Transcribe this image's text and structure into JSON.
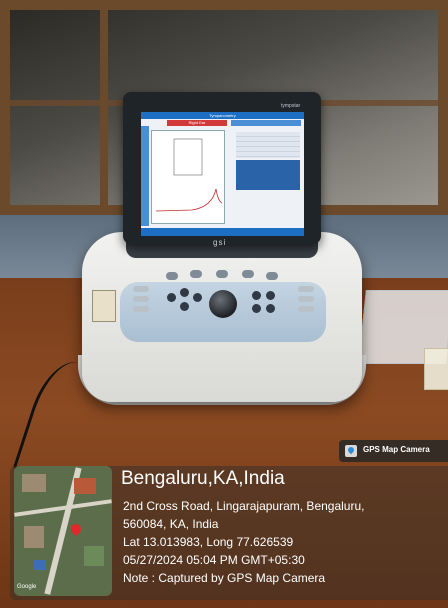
{
  "photo": {
    "monitor_brand": "tympstar",
    "device_logo": "gsi",
    "screen": {
      "title": "Tympanometry",
      "tab_label": "Right Ear"
    }
  },
  "gps_overlay": {
    "app_tag": "GPS Map Camera",
    "app_icon": "map-pin-icon",
    "location_title": "Bengaluru,KA,India",
    "address_line1": "2nd Cross Road, Lingarajapuram, Bengaluru,",
    "address_line2": "560084, KA, India",
    "coordinates": "Lat 13.013983, Long 77.626539",
    "timestamp": "05/27/2024 05:04 PM GMT+05:30",
    "note": "Note : Captured by GPS Map Camera",
    "map_attribution": "Google"
  }
}
